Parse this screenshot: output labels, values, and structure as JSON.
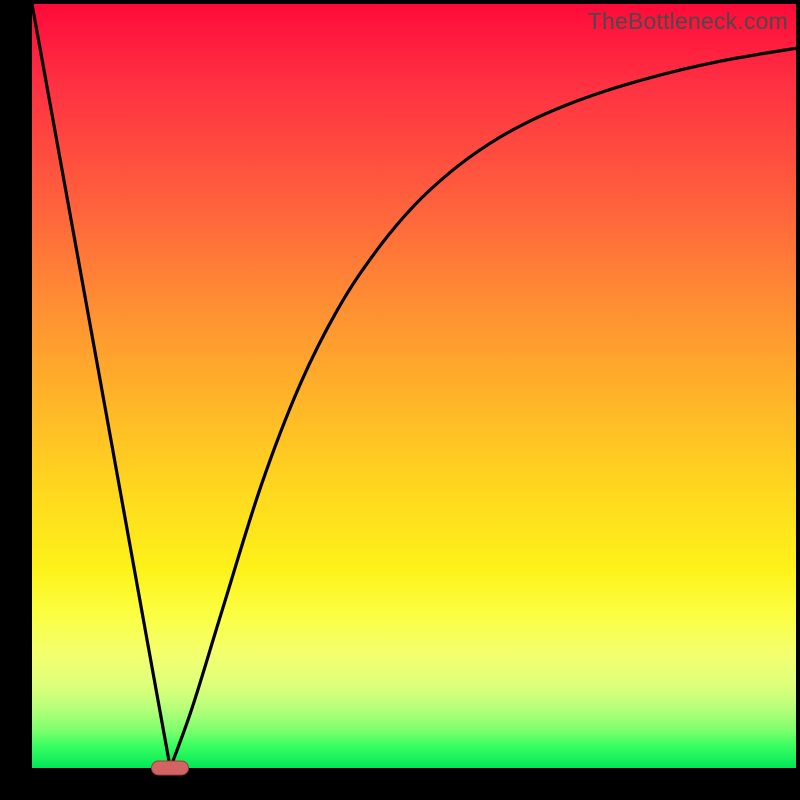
{
  "watermark": "TheBottleneck.com",
  "colors": {
    "frame": "#000000",
    "curve": "#000000",
    "marker_fill": "#d36464",
    "marker_stroke": "#a23c3c"
  },
  "chart_data": {
    "type": "line",
    "title": "",
    "xlabel": "",
    "ylabel": "",
    "xlim": [
      0,
      1
    ],
    "ylim": [
      0,
      1
    ],
    "legend": false,
    "grid": false,
    "series": [
      {
        "name": "bottleneck-curve",
        "x": [
          0.0,
          0.05,
          0.1,
          0.15,
          0.181,
          0.21,
          0.25,
          0.3,
          0.35,
          0.4,
          0.45,
          0.5,
          0.55,
          0.6,
          0.65,
          0.7,
          0.75,
          0.8,
          0.85,
          0.9,
          0.95,
          1.0
        ],
        "y": [
          1.0,
          0.724,
          0.448,
          0.171,
          0.0,
          0.08,
          0.21,
          0.37,
          0.5,
          0.6,
          0.676,
          0.736,
          0.782,
          0.818,
          0.846,
          0.868,
          0.886,
          0.901,
          0.914,
          0.925,
          0.934,
          0.942
        ]
      }
    ],
    "annotations": [
      {
        "name": "minimum-marker",
        "shape": "pill",
        "x": 0.181,
        "y": 0.0
      }
    ],
    "background_gradient_stops": [
      {
        "pos": 0.0,
        "color": "#ff0a3a"
      },
      {
        "pos": 0.1,
        "color": "#ff2f42"
      },
      {
        "pos": 0.24,
        "color": "#ff5a3e"
      },
      {
        "pos": 0.38,
        "color": "#ff8a34"
      },
      {
        "pos": 0.52,
        "color": "#ffb528"
      },
      {
        "pos": 0.64,
        "color": "#ffd91e"
      },
      {
        "pos": 0.74,
        "color": "#fef21a"
      },
      {
        "pos": 0.8,
        "color": "#fbff42"
      },
      {
        "pos": 0.85,
        "color": "#f4ff6e"
      },
      {
        "pos": 0.89,
        "color": "#e0ff7a"
      },
      {
        "pos": 0.92,
        "color": "#b9ff7a"
      },
      {
        "pos": 0.95,
        "color": "#80ff6e"
      },
      {
        "pos": 0.97,
        "color": "#3cff62"
      },
      {
        "pos": 1.0,
        "color": "#00e756"
      }
    ]
  }
}
